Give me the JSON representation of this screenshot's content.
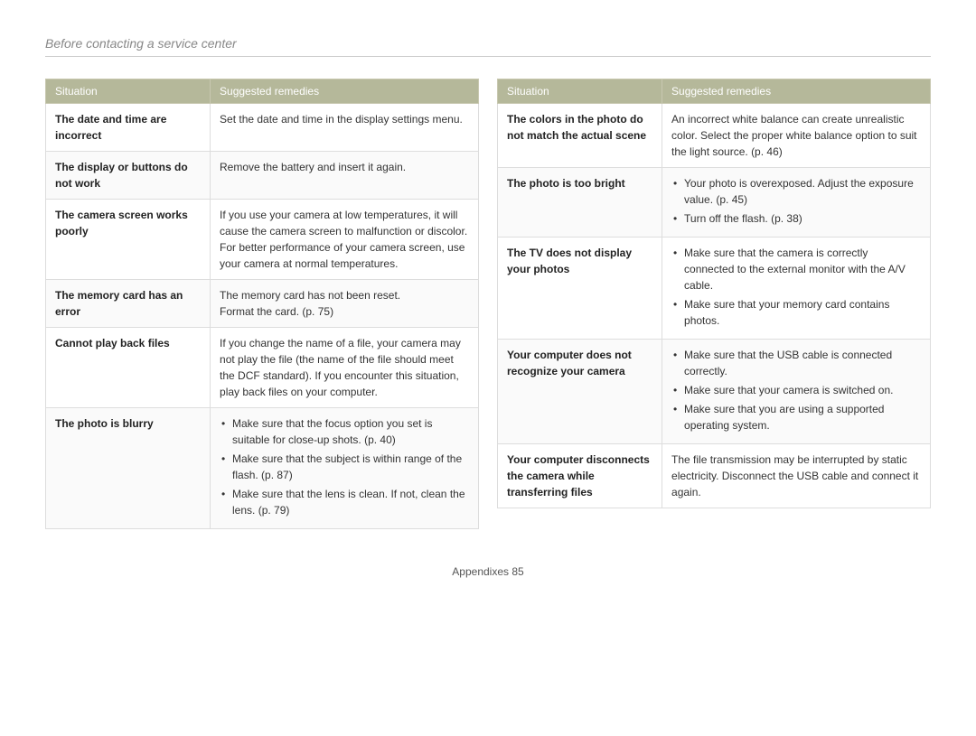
{
  "page": {
    "title": "Before contacting a service center",
    "footer": "Appendixes  85"
  },
  "left_table": {
    "col1": "Situation",
    "col2": "Suggested remedies",
    "rows": [
      {
        "situation": "The date and time are incorrect",
        "remedy_type": "text",
        "remedy": "Set the date and time in the display settings menu."
      },
      {
        "situation": "The display or buttons do not work",
        "remedy_type": "text",
        "remedy": "Remove the battery and insert it again."
      },
      {
        "situation": "The camera screen works poorly",
        "remedy_type": "text",
        "remedy": "If you use your camera at low temperatures, it will cause the camera screen to malfunction or discolor.\nFor better performance of your camera screen, use your camera at normal temperatures."
      },
      {
        "situation": "The memory card has an error",
        "remedy_type": "text",
        "remedy": "The memory card has not been reset.\nFormat the card. (p. 75)"
      },
      {
        "situation": "Cannot play back files",
        "remedy_type": "text",
        "remedy": "If you change the name of a file, your camera may not play the file (the name of the file should meet the DCF standard). If you encounter this situation, play back files on your computer."
      },
      {
        "situation": "The photo is blurry",
        "remedy_type": "list",
        "items": [
          "Make sure that the focus option you set is suitable for close-up shots. (p. 40)",
          "Make sure that the subject is within range of the flash. (p. 87)",
          "Make sure that the lens is clean. If not, clean the lens. (p. 79)"
        ]
      }
    ]
  },
  "right_table": {
    "col1": "Situation",
    "col2": "Suggested remedies",
    "rows": [
      {
        "situation": "The colors in the photo do not match the actual scene",
        "remedy_type": "text",
        "remedy": "An incorrect white balance can create unrealistic color. Select the proper white balance option to suit the light source. (p. 46)"
      },
      {
        "situation": "The photo is too bright",
        "remedy_type": "list",
        "items": [
          "Your photo is overexposed. Adjust the exposure value. (p. 45)",
          "Turn off the flash. (p. 38)"
        ]
      },
      {
        "situation": "The TV does not display your photos",
        "remedy_type": "list",
        "items": [
          "Make sure that the camera is correctly connected to the external monitor with the A/V cable.",
          "Make sure that your memory card contains photos."
        ]
      },
      {
        "situation": "Your computer does not recognize your camera",
        "remedy_type": "list",
        "items": [
          "Make sure that the USB cable is connected correctly.",
          "Make sure that your camera is switched on.",
          "Make sure that you are using a supported operating system."
        ]
      },
      {
        "situation": "Your computer disconnects the camera while transferring files",
        "remedy_type": "text",
        "remedy": "The file transmission may be interrupted by static electricity. Disconnect the USB cable and connect it again."
      }
    ]
  }
}
